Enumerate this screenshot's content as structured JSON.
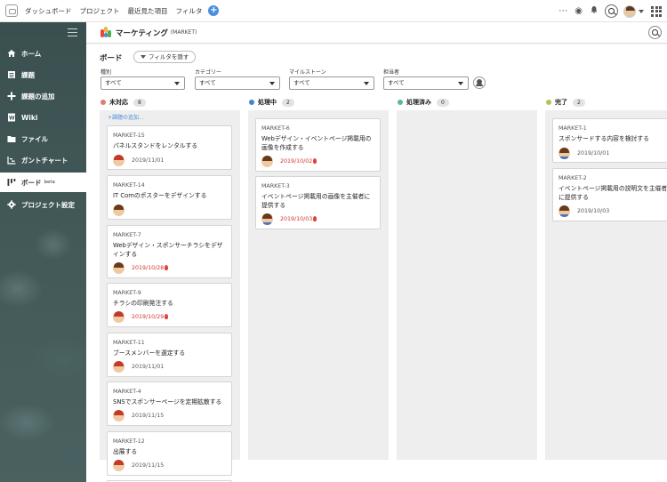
{
  "topnav": {
    "links": [
      "ダッシュボード",
      "プロジェクト",
      "最近見た項目",
      "フィルタ"
    ],
    "add_label": "+"
  },
  "sidebar": {
    "items": [
      {
        "label": "ホーム",
        "icon": "home-icon"
      },
      {
        "label": "課題",
        "icon": "list-icon"
      },
      {
        "label": "課題の追加",
        "icon": "plus-icon"
      },
      {
        "label": "Wiki",
        "icon": "wiki-icon"
      },
      {
        "label": "ファイル",
        "icon": "folder-icon"
      },
      {
        "label": "ガントチャート",
        "icon": "gantt-icon"
      },
      {
        "label": "ボード",
        "icon": "board-icon",
        "badge": "beta",
        "active": true
      },
      {
        "label": "プロジェクト設定",
        "icon": "gear-icon"
      }
    ]
  },
  "project": {
    "name": "マーケティング",
    "key": "(MARKET)"
  },
  "board": {
    "title": "ボード",
    "filter_toggle": "フィルタを隠す",
    "filters": [
      {
        "label": "種別",
        "value": "すべて"
      },
      {
        "label": "カテゴリー",
        "value": "すべて"
      },
      {
        "label": "マイルストーン",
        "value": "すべて"
      },
      {
        "label": "担当者",
        "value": "すべて"
      }
    ],
    "add_issue": "+課題の追加...",
    "columns": [
      {
        "name": "未対応",
        "count": "8",
        "color": "#e07a73",
        "cards": [
          {
            "key": "MARKET-15",
            "title": "パネルスタンドをレンタルする",
            "date": "2019/11/01",
            "late": false,
            "avatar": "red"
          },
          {
            "key": "MARKET-14",
            "title": "IT Comのポスターをデザインする",
            "date": "",
            "late": false,
            "avatar": "brown"
          },
          {
            "key": "MARKET-7",
            "title": "Webデザイン・スポンサーチラシをデザインする",
            "date": "2019/10/28",
            "late": true,
            "avatar": "brown"
          },
          {
            "key": "MARKET-9",
            "title": "チラシの印刷発注する",
            "date": "2019/10/29",
            "late": true,
            "avatar": "red"
          },
          {
            "key": "MARKET-11",
            "title": "ブースメンバーを選定する",
            "date": "2019/11/01",
            "late": false,
            "avatar": "red"
          },
          {
            "key": "MARKET-4",
            "title": "SNSでスポンサーページを定期拡散する",
            "date": "2019/11/15",
            "late": false,
            "avatar": "red"
          },
          {
            "key": "MARKET-12",
            "title": "出展する",
            "date": "2019/11/15",
            "late": false,
            "avatar": "red"
          }
        ]
      },
      {
        "name": "処理中",
        "count": "2",
        "color": "#3e86cf",
        "cards": [
          {
            "key": "MARKET-6",
            "title": "Webデザイン・イベントページ掲載用の画像を作成する",
            "date": "2019/10/02",
            "late": true,
            "avatar": "brown"
          },
          {
            "key": "MARKET-3",
            "title": "イベントページ掲載用の画像を主催者に提供する",
            "date": "2019/10/03",
            "late": true,
            "avatar": "blue"
          }
        ]
      },
      {
        "name": "処理済み",
        "count": "0",
        "color": "#5eb5a6",
        "cards": []
      },
      {
        "name": "完了",
        "count": "2",
        "color": "#a8c94e",
        "cards": [
          {
            "key": "MARKET-1",
            "title": "スポンサードする内容を検討する",
            "date": "2019/10/01",
            "late": false,
            "avatar": "blue"
          },
          {
            "key": "MARKET-2",
            "title": "イベントページ掲載用の説明文を主催者に提供する",
            "date": "2019/10/03",
            "late": false,
            "avatar": "blue"
          }
        ]
      }
    ]
  }
}
